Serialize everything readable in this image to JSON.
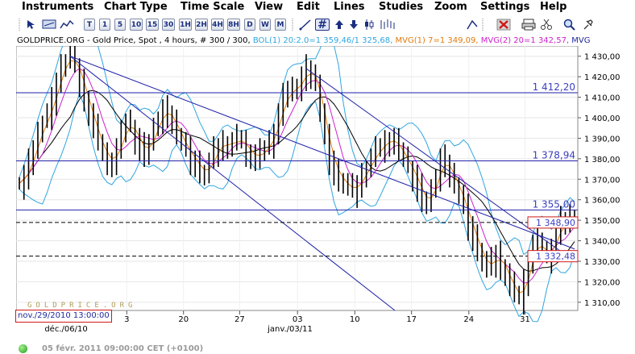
{
  "menu": [
    "Instruments",
    "Chart Type",
    "Time Scale",
    "View",
    "Edit",
    "Lines",
    "Studies",
    "Zoom",
    "Settings",
    "Help"
  ],
  "toolbar": {
    "buttons": [
      "T",
      "1",
      "5",
      "10",
      "15",
      "30",
      "1H",
      "2H",
      "4H",
      "8H",
      "D",
      "W",
      "M"
    ],
    "hash_label": "#",
    "icons": [
      "cursor-icon",
      "hash-icon",
      "up-arrow-icon",
      "down-arrow-icon",
      "candle-icon",
      "bars-icon",
      "delete-icon",
      "print-icon",
      "cut-icon",
      "zoom-icon",
      "pin-icon"
    ]
  },
  "status": {
    "instrument": "GOLDPRICE.ORG - Gold Price, Spot , 4 hours, # 300 / 300,",
    "bol": "BOL(1) 20:2.0=1 359,46/1 325,68,",
    "mvg1": "MVG(1) 7=1 349,09,",
    "mvg2": "MVG(2) 20=1 342,57,",
    "mvg_more": "MVG"
  },
  "colors": {
    "bol": "#2fa5e0",
    "mvg1": "#e07b0c",
    "mvg2": "#cc22cc",
    "sma": "#000000",
    "price": "#000000",
    "trend": "#2222aa",
    "label": "#3a3fc0"
  },
  "chart_data": {
    "type": "ohlc",
    "y_tick_labels": [
      "1 430,00",
      "1 420,00",
      "1 410,00",
      "1 400,00",
      "1 390,00",
      "1 380,00",
      "1 370,00",
      "1 360,00",
      "1 350,00",
      "1 340,00",
      "1 330,00",
      "1 320,00",
      "1 310,00"
    ],
    "ylim": [
      1306,
      1435
    ],
    "x_tick_labels": [
      "3",
      "20",
      "27",
      "03",
      "10",
      "17",
      "24",
      "31"
    ],
    "x_date_labels": [
      "déc./06/10",
      "janv./03/11"
    ],
    "levels": [
      {
        "value": 1412.2,
        "label": "1 412,20",
        "style": "solid"
      },
      {
        "value": 1378.94,
        "label": "1 378,94",
        "style": "solid"
      },
      {
        "value": 1355.0,
        "label": "1 355,00",
        "style": "solid"
      },
      {
        "value": 1348.9,
        "label": "1 348,90",
        "style": "dashed",
        "boxed": true
      },
      {
        "value": 1332.48,
        "label": "1 332,48",
        "style": "dashed",
        "boxed": true
      }
    ],
    "close": [
      1368,
      1372,
      1378,
      1385,
      1392,
      1398,
      1402,
      1408,
      1418,
      1425,
      1428,
      1430,
      1425,
      1418,
      1410,
      1402,
      1395,
      1388,
      1382,
      1380,
      1378,
      1385,
      1392,
      1398,
      1396,
      1390,
      1386,
      1382,
      1388,
      1394,
      1400,
      1404,
      1402,
      1398,
      1392,
      1388,
      1384,
      1380,
      1378,
      1374,
      1372,
      1378,
      1384,
      1386,
      1388,
      1386,
      1388,
      1390,
      1388,
      1384,
      1382,
      1380,
      1383,
      1385,
      1388,
      1394,
      1402,
      1410,
      1414,
      1412,
      1416,
      1420,
      1424,
      1420,
      1418,
      1402,
      1390,
      1380,
      1374,
      1370,
      1368,
      1366,
      1364,
      1368,
      1372,
      1376,
      1380,
      1384,
      1386,
      1388,
      1390,
      1388,
      1384,
      1380,
      1376,
      1372,
      1366,
      1360,
      1358,
      1364,
      1372,
      1380,
      1378,
      1372,
      1368,
      1362,
      1356,
      1348,
      1342,
      1336,
      1330,
      1326,
      1330,
      1334,
      1328,
      1324,
      1318,
      1314,
      1312,
      1320,
      1330,
      1338,
      1340,
      1334,
      1332,
      1338,
      1344,
      1350,
      1348,
      1352,
      1349
    ]
  },
  "watermark": "GOLDPRICE.ORG",
  "date_box": "nov./29/2010 13:00:00",
  "footer_text": "05 févr. 2011 09:00:00  CET (+0100)"
}
